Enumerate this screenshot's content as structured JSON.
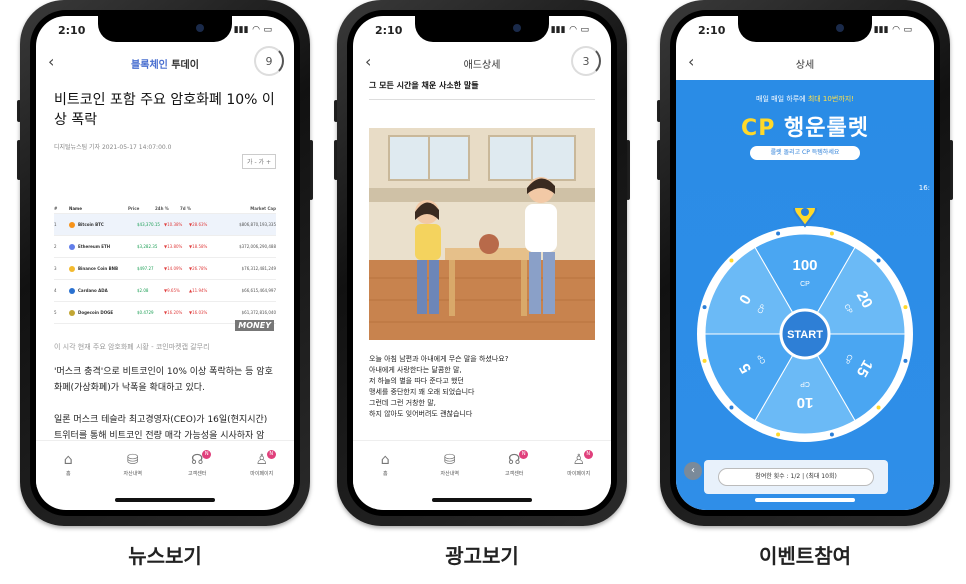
{
  "status": {
    "time": "2:10"
  },
  "tabs": [
    {
      "label": "홈",
      "icon": "home-icon"
    },
    {
      "label": "자산내역",
      "icon": "coins-icon"
    },
    {
      "label": "고객센터",
      "icon": "headset-icon",
      "badge": "N"
    },
    {
      "label": "마이페이지",
      "icon": "user-icon",
      "badge": "N"
    }
  ],
  "news": {
    "logo_a": "블록체인",
    "logo_b": "투데이",
    "counter": "9",
    "title": "비트코인 포함 주요 암호화폐 10% 이상 폭락",
    "meta": "디지털뉴스팀 기자   2021-05-17 14:07:00.0",
    "font_control": "가 -  가 +",
    "table_head": [
      "#",
      "Name",
      "Price",
      "24h %",
      "7d %",
      "Market Cap"
    ],
    "rows": [
      {
        "num": "1",
        "name": "Bitcoin BTC",
        "price": "$43,370.15",
        "d": "▼10.38%",
        "w": "▼28.63%",
        "mcap": "$806,870,193,335",
        "color": "#f7931a"
      },
      {
        "num": "2",
        "name": "Ethereum ETH",
        "price": "$3,282.35",
        "d": "▼13.80%",
        "w": "▼18.58%",
        "mcap": "$372,006,290,488",
        "color": "#627eea"
      },
      {
        "num": "3",
        "name": "Binance Coin BNB",
        "price": "$497.27",
        "d": "▼14.09%",
        "w": "▼26.78%",
        "mcap": "$76,312,481,249",
        "color": "#f3ba2f"
      },
      {
        "num": "4",
        "name": "Cardano ADA",
        "price": "$2.08",
        "d": "▼9.65%",
        "w": "▲11.94%",
        "mcap": "$66,615,464,997",
        "color": "#2a71d0"
      },
      {
        "num": "5",
        "name": "Dogecoin DOGE",
        "price": "$0.4729",
        "d": "▼16.20%",
        "w": "▼16.03%",
        "mcap": "$61,372,816,040",
        "color": "#c2a633"
      }
    ],
    "watermark": "MONEY",
    "caption": "이 시각 현재 주요 암호화폐 시황 - 코인마켓캡 갈무리",
    "para1": "'머스크 충격'으로 비트코인이 10% 이상 폭락하는 등 암호화폐(가상화폐)가 낙폭을 확대하고 있다.",
    "para2": "일론 머스크 테슬라 최고경영자(CEO)가 16일(현지시간) 트위터를 통해 비트코인 전량 매각 가능성을 시사하자 암"
  },
  "ad": {
    "title": "애드상세",
    "counter": "3",
    "heading": "그 모든 시간을 채운 사소한 말들",
    "lines": [
      "오늘 아침 남편과 아내에게 무슨 말을 하셨나요?",
      "아내에게 사랑한다는 달콤한 말,",
      "저 하늘의 별을 따다 준다고 했던",
      "맹세를 중단한지 꽤 오래 되었습니다",
      "그런데 그런 거창한 말,",
      "하지 않아도 잊어버려도 괜찮습니다"
    ]
  },
  "event": {
    "title": "상세",
    "sub_a": "매일 매일 하루에 ",
    "sub_b": "최대 10번까지!",
    "title_cp": "CP",
    "title_rest": " 행운룰렛",
    "pill": "룰렛 돌리고 CP 득템하세요",
    "time": "16:",
    "segments": [
      "100",
      "20",
      "15",
      "10",
      "5",
      "0"
    ],
    "unit": "CP",
    "start": "START",
    "count": "참여한 횟수 : 1/2  |  (최대 10회)"
  },
  "labels": [
    "뉴스보기",
    "광고보기",
    "이벤트참여"
  ],
  "colors": {
    "accent": "#e0407c",
    "event_blue": "#2f8ee8",
    "event_yellow": "#ffd92a"
  }
}
